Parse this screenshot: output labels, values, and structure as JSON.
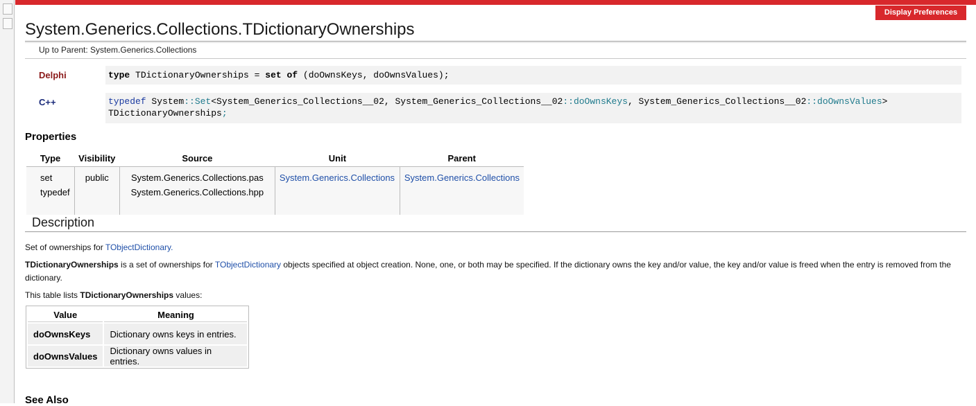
{
  "header": {
    "display_prefs": "Display Preferences",
    "title": "System.Generics.Collections.TDictionaryOwnerships",
    "breadcrumb": "Up to Parent: System.Generics.Collections"
  },
  "declarations": {
    "delphi": {
      "label": "Delphi",
      "kw_type": "type",
      "name": " TDictionaryOwnerships = ",
      "kw_set": "set",
      "space": " ",
      "kw_of": "of",
      "rest": " (doOwnsKeys, doOwnsValues);"
    },
    "cpp": {
      "label": "C++",
      "typedef": "typedef",
      "ns1": " System",
      "sep1": "::",
      "set": "Set",
      "tmpl1": "<System_Generics_Collections__02, System_Generics_Collections__02",
      "sep2": "::",
      "keys": "doOwnsKeys",
      "tmpl2": ", System_Generics_Collections__02",
      "sep3": "::",
      "values": "doOwnsValues",
      "close": ">",
      "line2": "TDictionaryOwnerships",
      "semi": ";"
    }
  },
  "properties": {
    "heading": "Properties",
    "columns": [
      "Type",
      "Visibility",
      "Source",
      "Unit",
      "Parent"
    ],
    "types": [
      "set",
      "typedef"
    ],
    "visibility": "public",
    "sources": [
      "System.Generics.Collections.pas",
      "System.Generics.Collections.hpp"
    ],
    "unit": "System.Generics.Collections",
    "parent": "System.Generics.Collections"
  },
  "description": {
    "heading": "Description",
    "p1_text": "Set of ownerships for ",
    "p1_link": "TObjectDictionary",
    "p1_end": ".",
    "p2_bold": "TDictionaryOwnerships",
    "p2_text": " is a set of ownerships for ",
    "p2_link": "TObjectDictionary",
    "p2_rest": " objects specified at object creation. None, one, or both may be specified. If the dictionary owns the key and/or value, the key and/or value is freed when the entry is removed from the dictionary.",
    "p3_text": "This table lists ",
    "p3_bold": "TDictionaryOwnerships",
    "p3_end": " values:"
  },
  "values_table": {
    "columns": [
      "Value",
      "Meaning"
    ],
    "rows": [
      {
        "value": "doOwnsKeys",
        "meaning": "Dictionary owns keys in entries."
      },
      {
        "value": "doOwnsValues",
        "meaning": "Dictionary owns values in entries."
      }
    ]
  },
  "see_also": {
    "heading": "See Also"
  },
  "colors": {
    "accent_red": "#d8282c",
    "link_blue": "#1f4fa8"
  }
}
